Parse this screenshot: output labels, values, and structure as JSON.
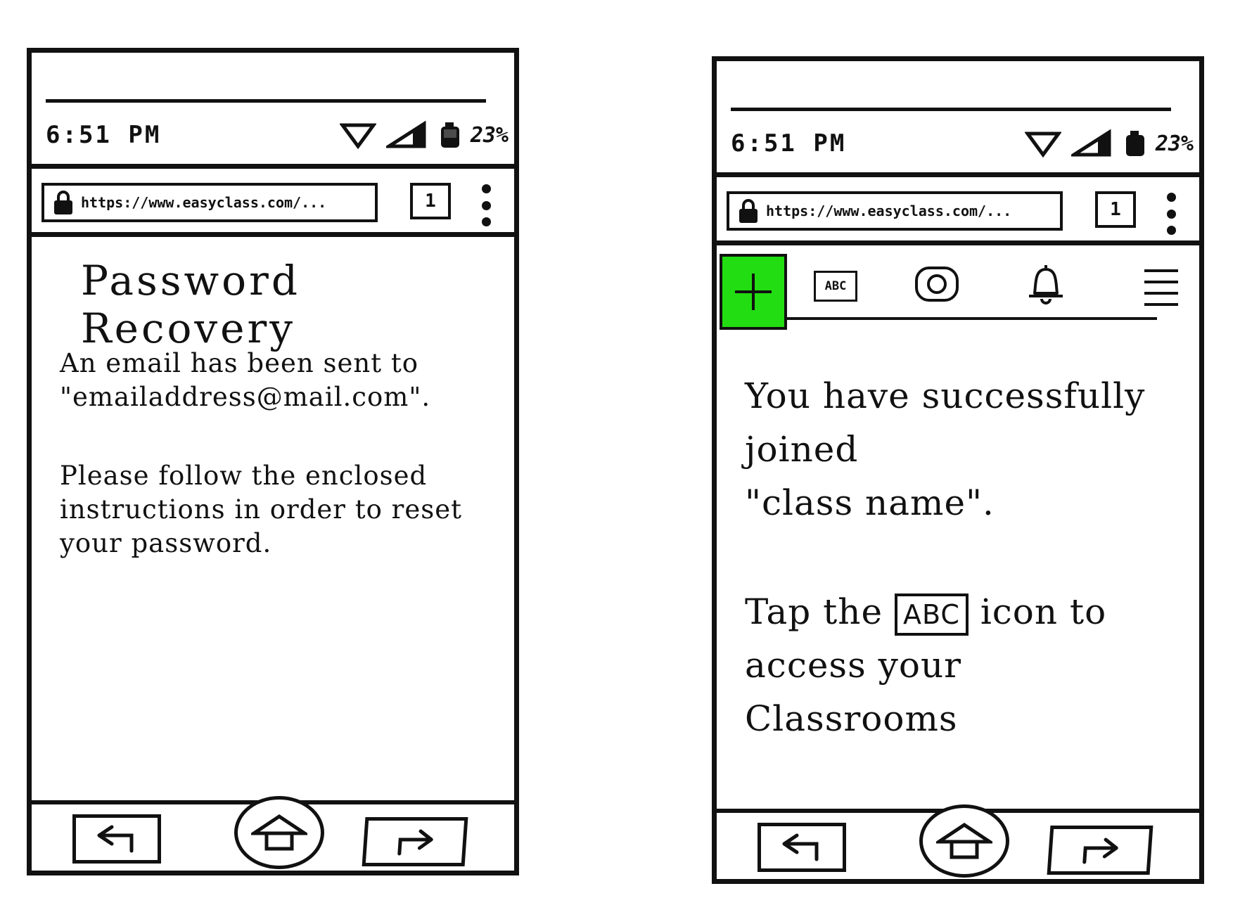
{
  "left_phone": {
    "status": {
      "time": "6:51 PM",
      "battery": "23%"
    },
    "browser": {
      "url": "https://www.easyclass.com/...",
      "tab_count": "1"
    },
    "title": "Password Recovery",
    "paragraph1": "An email has been sent to \"emailaddress@mail.com\".",
    "paragraph2": "Please follow the enclosed instructions in order to reset your password."
  },
  "right_phone": {
    "status": {
      "time": "6:51 PM",
      "battery": "23%"
    },
    "browser": {
      "url": "https://www.easyclass.com/...",
      "tab_count": "1"
    },
    "toolbar": {
      "abc_label": "ABC",
      "plus_color": "#22dd11"
    },
    "message_line1": "You have successfully joined",
    "message_line2": "\"class name\".",
    "tap_prefix": "Tap the",
    "tap_abc": "ABC",
    "tap_suffix": "icon to access your Classrooms"
  },
  "icons": [
    "lock-icon",
    "wifi-icon",
    "signal-icon",
    "battery-icon",
    "plus-icon",
    "abc-icon",
    "camera-icon",
    "bell-icon",
    "menu-icon",
    "back-icon",
    "home-icon",
    "forward-icon"
  ]
}
